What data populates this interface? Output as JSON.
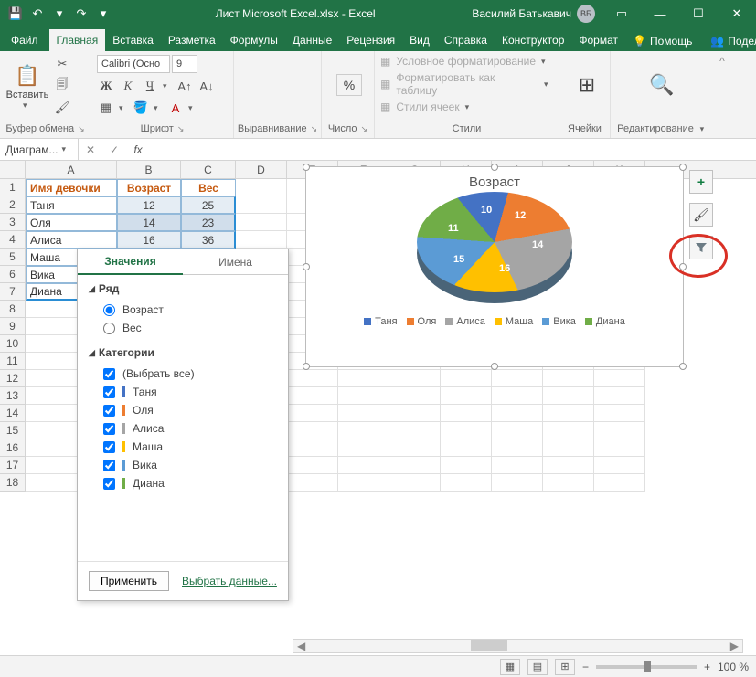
{
  "titlebar": {
    "doc_title": "Лист Microsoft Excel.xlsx  -  Excel",
    "user_name": "Василий Батькавич",
    "user_initials": "ВБ"
  },
  "tabs": {
    "file": "Файл",
    "home": "Главная",
    "insert": "Вставка",
    "layout": "Разметка",
    "formulas": "Формулы",
    "data": "Данные",
    "review": "Рецензия",
    "view": "Вид",
    "help": "Справка",
    "design": "Конструктор",
    "format": "Формат",
    "assist": "Помощь",
    "share": "Поделиться"
  },
  "ribbon": {
    "clipboard": {
      "paste": "Вставить",
      "group": "Буфер обмена"
    },
    "font": {
      "name": "Calibri (Осно",
      "size": "9",
      "group": "Шрифт"
    },
    "alignment": {
      "group": "Выравнивание"
    },
    "number": {
      "symbol": "%",
      "group": "Число"
    },
    "styles": {
      "cond": "Условное форматирование",
      "table": "Форматировать как таблицу",
      "cell": "Стили ячеек",
      "group": "Стили"
    },
    "cells": {
      "group": "Ячейки"
    },
    "editing": {
      "group": "Редактирование"
    }
  },
  "namebox": "Диаграм...",
  "columns": [
    "A",
    "B",
    "C",
    "D",
    "E",
    "F",
    "G",
    "H",
    "I",
    "J",
    "K"
  ],
  "table": {
    "headers": {
      "name": "Имя девочки",
      "age": "Возраст",
      "weight": "Вес"
    },
    "rows": [
      {
        "name": "Таня",
        "age": "12",
        "weight": "25"
      },
      {
        "name": "Оля",
        "age": "14",
        "weight": "23"
      },
      {
        "name": "Алиса",
        "age": "16",
        "weight": "36"
      },
      {
        "name": "Маша",
        "age": "",
        "weight": ""
      },
      {
        "name": "Вика",
        "age": "",
        "weight": ""
      },
      {
        "name": "Диана",
        "age": "",
        "weight": ""
      }
    ]
  },
  "chart": {
    "title": "Возраст",
    "legend": [
      "Таня",
      "Оля",
      "Алиса",
      "Маша",
      "Вика",
      "Диана"
    ],
    "colors": [
      "#4472c4",
      "#ed7d31",
      "#a5a5a5",
      "#ffc000",
      "#5b9bd5",
      "#70ad47"
    ],
    "labels": [
      "12",
      "14",
      "16",
      "15",
      "11",
      "10"
    ]
  },
  "popup": {
    "tab_values": "Значения",
    "tab_names": "Имена",
    "series_label": "Ряд",
    "series": [
      "Возраст",
      "Вес"
    ],
    "categories_label": "Категории",
    "select_all": "(Выбрать все)",
    "categories": [
      "Таня",
      "Оля",
      "Алиса",
      "Маша",
      "Вика",
      "Диана"
    ],
    "apply": "Применить",
    "select_data": "Выбрать данные..."
  },
  "status": {
    "zoom": "100 %",
    "plus": "+",
    "minus": "−"
  },
  "chart_data": {
    "type": "pie",
    "title": "Возраст",
    "categories": [
      "Таня",
      "Оля",
      "Алиса",
      "Маша",
      "Вика",
      "Диана"
    ],
    "values": [
      12,
      14,
      16,
      15,
      11,
      10
    ],
    "colors": [
      "#4472c4",
      "#ed7d31",
      "#a5a5a5",
      "#ffc000",
      "#5b9bd5",
      "#70ad47"
    ],
    "legend_position": "bottom"
  }
}
